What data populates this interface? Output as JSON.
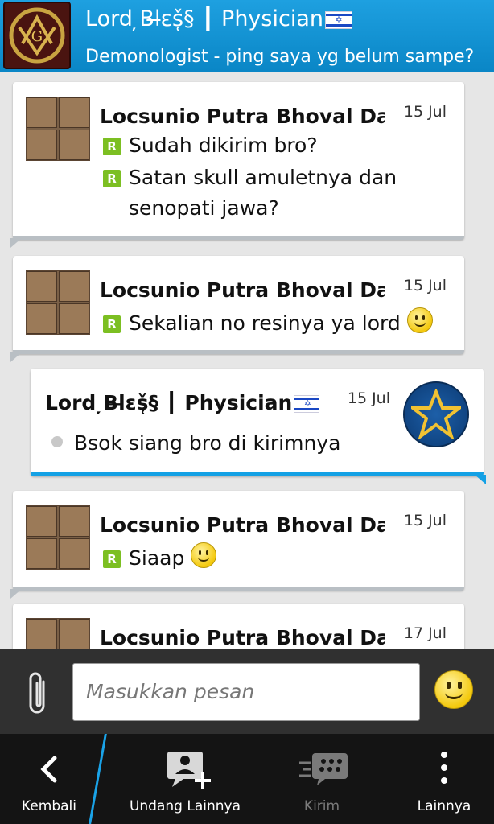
{
  "header": {
    "title": "Lord ̦Bl̶ɛš̜§ ┃ Physician",
    "flag_symbol": "✡",
    "status": "Demonologist - ping saya yg belum sampe?"
  },
  "messages": [
    {
      "sender": "Locsunio Putra Bhoval Dae",
      "time": "15 Jul",
      "lines": [
        "Sudah dikirim bro?",
        "Satan skull amuletnya dan",
        "senopati jawa?"
      ],
      "marker": "R"
    },
    {
      "sender": "Locsunio Putra Bhoval Dae",
      "time": "15 Jul",
      "lines": [
        "Sekalian no resinya ya lord"
      ],
      "marker": "R"
    },
    {
      "sender": "Lord ̦Bl̶ɛš̜§ ┃ Physician",
      "time": "15 Jul",
      "lines": [
        "Bsok siang bro di kirimnya"
      ]
    },
    {
      "sender": "Locsunio Putra Bhoval Dae",
      "time": "15 Jul",
      "lines": [
        "Siaap"
      ],
      "marker": "R"
    },
    {
      "sender": "Locsunio Putra Bhoval Dae",
      "time": "17 Jul",
      "lines": []
    }
  ],
  "composer": {
    "placeholder": "Masukkan pesan"
  },
  "bottombar": {
    "back": "Kembali",
    "invite": "Undang Lainnya",
    "send": "Kirim",
    "more": "Lainnya"
  },
  "colors": {
    "header": "#0a86c6",
    "accent": "#14a1e5",
    "read_marker": "#7cbf22"
  }
}
